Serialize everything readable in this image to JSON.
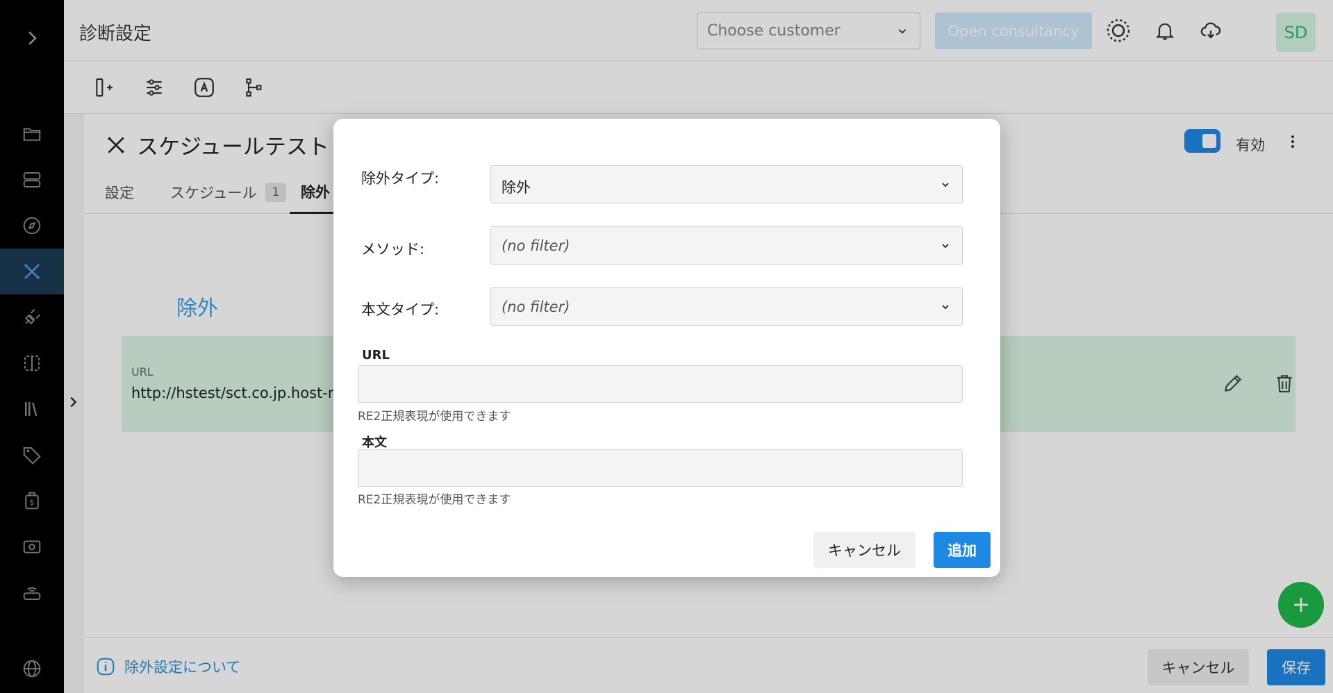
{
  "header": {
    "page_title": "診断設定",
    "customer_placeholder": "Choose customer",
    "consult_label": "Open consultancy",
    "avatar_initials": "SD"
  },
  "inner": {
    "title": "スケジュールテスト ト",
    "enabled_label": "有効",
    "tabs": [
      {
        "label": "設定"
      },
      {
        "label": "スケジュール",
        "badge": "1"
      },
      {
        "label": "除外"
      }
    ],
    "section_title": "除外",
    "rule": {
      "label": "URL",
      "value": "http://hstest/sct.co.jp.host-m"
    }
  },
  "footer": {
    "help_link": "除外設定について",
    "cancel_label": "キャンセル",
    "save_label": "保存"
  },
  "modal": {
    "exclusion_type_label": "除外タイプ:",
    "exclusion_type_value": "除外",
    "method_label": "メソッド:",
    "method_value": "(no filter)",
    "body_type_label": "本文タイプ:",
    "body_type_value": "(no filter)",
    "url_label": "URL",
    "url_help": "RE2正規表現が使用できます",
    "body_label": "本文",
    "body_help": "RE2正規表現が使用できます",
    "cancel_label": "キャンセル",
    "add_label": "追加"
  },
  "colors": {
    "accent": "#1e88e5",
    "rule_row_bg": "#dbf5e2",
    "fab": "#1fb84c",
    "nav_active": "#1c3b55"
  }
}
